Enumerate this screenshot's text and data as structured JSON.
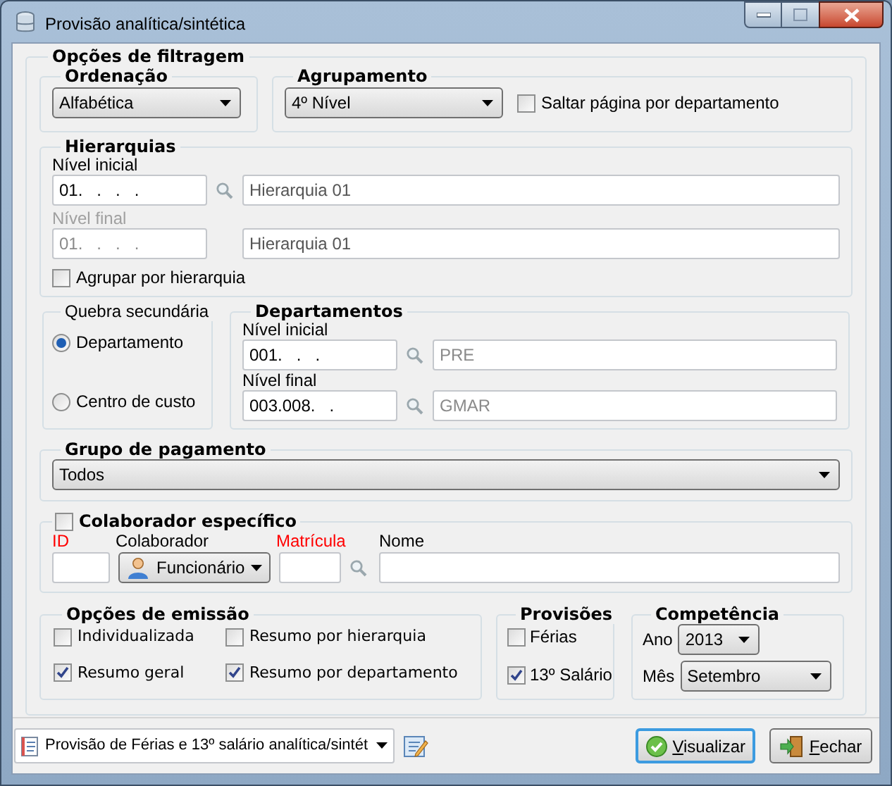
{
  "window": {
    "title": "Provisão analítica/sintética"
  },
  "filters": {
    "title": "Opções de filtragem"
  },
  "ordering": {
    "title": "Ordenação",
    "value": "Alfabética"
  },
  "grouping": {
    "title": "Agrupamento",
    "value": "4º Nível",
    "skip_page": {
      "label": "Saltar página por departamento",
      "checked": false
    }
  },
  "hierarchies": {
    "title": "Hierarquias",
    "levels": [
      {
        "label": "Nível inicial",
        "code": "01.   .   .   .",
        "name": "Hierarquia 01",
        "disabled": false
      },
      {
        "label": "Nível final",
        "code": "01.   .   .   .",
        "name": "Hierarquia 01",
        "disabled": true
      }
    ],
    "group_by": {
      "label": "Agrupar por hierarquia",
      "checked": false
    }
  },
  "secondary_break": {
    "title": "Quebra secundária",
    "options": [
      {
        "label": "Departamento",
        "selected": true
      },
      {
        "label": "Centro de custo",
        "selected": false
      }
    ]
  },
  "departments": {
    "title": "Departamentos",
    "levels": [
      {
        "label": "Nível inicial",
        "code": "001.   .   .",
        "name": "PRE"
      },
      {
        "label": "Nível final",
        "code": "003.008.   .",
        "name": "GMAR"
      }
    ]
  },
  "payment_group": {
    "title": "Grupo de pagamento",
    "value": "Todos"
  },
  "employee": {
    "title": "Colaborador específico",
    "checked": false,
    "fields": [
      {
        "kind": "text",
        "label": "ID",
        "required": true
      },
      {
        "kind": "dropdown",
        "label": "Colaborador",
        "value": "Funcionário",
        "required": false
      },
      {
        "kind": "lookup",
        "label": "Matrícula",
        "required": true
      },
      {
        "kind": "wide",
        "label": "Nome",
        "required": false
      }
    ]
  },
  "emission": {
    "title": "Opções de emissão",
    "options": [
      {
        "label": "Individualizada",
        "checked": false
      },
      {
        "label": "Resumo por hierarquia",
        "checked": false
      },
      {
        "label": "Resumo geral",
        "checked": true
      },
      {
        "label": "Resumo por departamento",
        "checked": true
      }
    ]
  },
  "provisions": {
    "title": "Provisões",
    "options": [
      {
        "label": "Férias",
        "checked": false
      },
      {
        "label": "13º Salário",
        "checked": true
      }
    ]
  },
  "period": {
    "title": "Competência",
    "year": {
      "label": "Ano",
      "value": "2013"
    },
    "month": {
      "label": "Mês",
      "value": "Setembro"
    }
  },
  "footer": {
    "report": "Provisão de Férias e 13º salário analítica/sintét",
    "buttons": [
      {
        "kind": "view",
        "label": "Visualizar",
        "focused": true
      },
      {
        "kind": "close",
        "label": "Fechar",
        "focused": false
      }
    ]
  }
}
